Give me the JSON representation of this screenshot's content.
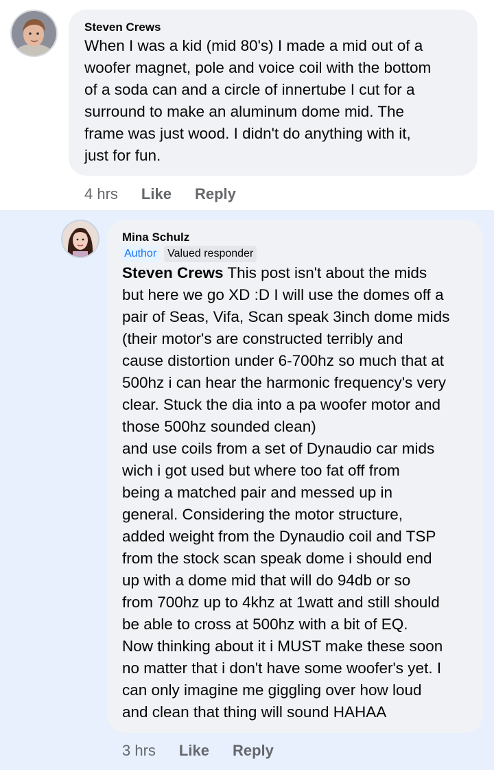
{
  "comment": {
    "author": "Steven Crews",
    "lines": [
      "When I was a kid (mid 80's) I made a mid out of a",
      "woofer magnet, pole and voice coil with the bottom",
      "of a soda can and a circle of innertube I cut for a",
      "surround to make an aluminum dome mid.  The",
      "frame was just wood.  I didn't do anything with it,",
      "just for fun."
    ],
    "time": "4 hrs",
    "like_label": "Like",
    "reply_label": "Reply"
  },
  "reply": {
    "author": "Mina Schulz",
    "badges": {
      "author": "Author",
      "valued": "Valued responder"
    },
    "mention": "Steven Crews",
    "first_line_rest": " This post isn't about the mids",
    "lines": [
      "but here we go XD :D I will use the domes off a",
      "pair of Seas, Vifa, Scan speak 3inch dome mids",
      "(their motor's are constructed terribly and",
      "cause distortion under 6-700hz so much that at",
      "500hz i can hear the harmonic frequency's very",
      "clear. Stuck the dia into a pa woofer motor and",
      "those 500hz sounded clean)",
      "and use coils from a set of Dynaudio car mids",
      "wich i got used but where too fat off from",
      "being a matched pair and messed up in",
      "general. Considering the motor structure,",
      "added weight from the Dynaudio coil and TSP",
      "from the stock scan speak dome i should end",
      "up with a dome mid that will do 94db or so",
      "from 700hz up to 4khz at 1watt and still should",
      "be able to cross at 500hz with a bit of EQ.",
      "Now thinking about it i MUST make these soon",
      "no matter that i don't have some woofer's yet. I",
      "can only imagine me giggling over how loud",
      "and clean that thing will sound HAHAA"
    ],
    "time": "3 hrs",
    "like_label": "Like",
    "reply_label": "Reply"
  },
  "colors": {
    "reply_background": "#e7f0fc",
    "bubble": "#f0f2f5",
    "meta_text": "#65676b",
    "author_badge_text": "#1877f2"
  }
}
